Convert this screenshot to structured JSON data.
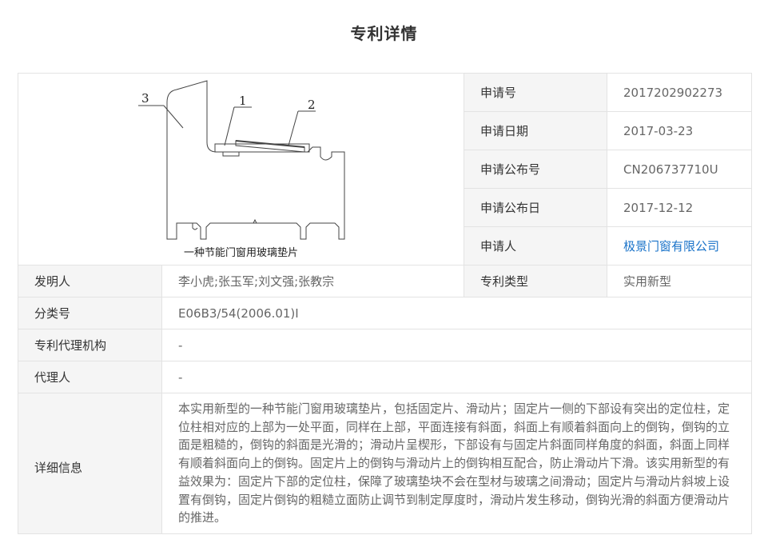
{
  "page": {
    "title": "专利详情"
  },
  "figure": {
    "caption": "一种节能门窗用玻璃垫片",
    "labels": [
      "3",
      "1",
      "2"
    ]
  },
  "fields": {
    "application_no": {
      "label": "申请号",
      "value": "2017202902273"
    },
    "application_date": {
      "label": "申请日期",
      "value": "2017-03-23"
    },
    "publication_no": {
      "label": "申请公布号",
      "value": "CN206737710U"
    },
    "publication_date": {
      "label": "申请公布日",
      "value": "2017-12-12"
    },
    "applicant": {
      "label": "申请人",
      "value": "极景门窗有限公司"
    },
    "inventor": {
      "label": "发明人",
      "value": "李小虎;张玉军;刘文强;张教宗"
    },
    "patent_type": {
      "label": "专利类型",
      "value": "实用新型"
    },
    "classification": {
      "label": "分类号",
      "value": "E06B3/54(2006.01)I"
    },
    "agency": {
      "label": "专利代理机构",
      "value": "-"
    },
    "agent": {
      "label": "代理人",
      "value": "-"
    },
    "details": {
      "label": "详细信息",
      "value": "本实用新型的一种节能门窗用玻璃垫片，包括固定片、滑动片；固定片一侧的下部设有突出的定位柱，定位柱相对应的上部为一处平面，同样在上部，平面连接有斜面，斜面上有顺着斜面向上的倒钩，倒钩的立面是粗糙的，倒钩的斜面是光滑的；滑动片呈楔形，下部设有与固定片斜面同样角度的斜面，斜面上同样有顺着斜面向上的倒钩。固定片上的倒钩与滑动片上的倒钩相互配合，防止滑动片下滑。该实用新型的有益效果为：固定片下部的定位柱，保障了玻璃垫块不会在型材与玻璃之间滑动；固定片与滑动片斜坡上设置有倒钩，固定片倒钩的粗糙立面防止调节到制定厚度时，滑动片发生移动，倒钩光滑的斜面方便滑动片的推进。"
    }
  },
  "colors": {
    "link": "#1a73c9",
    "label_bg": "#f5f5f5",
    "border": "#e3e3e3"
  }
}
